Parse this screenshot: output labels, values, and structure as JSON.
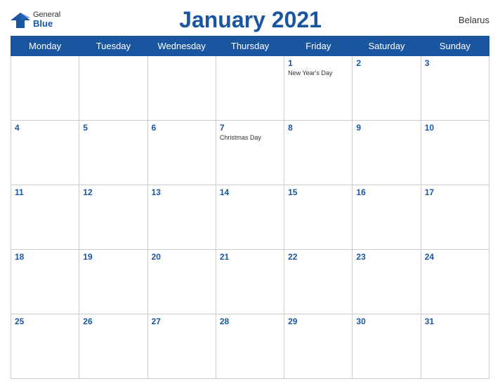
{
  "logo": {
    "general": "General",
    "blue": "Blue",
    "bird_color": "#1a56a0"
  },
  "title": "January 2021",
  "country": "Belarus",
  "days_of_week": [
    "Monday",
    "Tuesday",
    "Wednesday",
    "Thursday",
    "Friday",
    "Saturday",
    "Sunday"
  ],
  "weeks": [
    [
      {
        "day": "",
        "holiday": ""
      },
      {
        "day": "",
        "holiday": ""
      },
      {
        "day": "",
        "holiday": ""
      },
      {
        "day": "",
        "holiday": ""
      },
      {
        "day": "1",
        "holiday": "New Year's Day"
      },
      {
        "day": "2",
        "holiday": ""
      },
      {
        "day": "3",
        "holiday": ""
      }
    ],
    [
      {
        "day": "4",
        "holiday": ""
      },
      {
        "day": "5",
        "holiday": ""
      },
      {
        "day": "6",
        "holiday": ""
      },
      {
        "day": "7",
        "holiday": "Christmas Day"
      },
      {
        "day": "8",
        "holiday": ""
      },
      {
        "day": "9",
        "holiday": ""
      },
      {
        "day": "10",
        "holiday": ""
      }
    ],
    [
      {
        "day": "11",
        "holiday": ""
      },
      {
        "day": "12",
        "holiday": ""
      },
      {
        "day": "13",
        "holiday": ""
      },
      {
        "day": "14",
        "holiday": ""
      },
      {
        "day": "15",
        "holiday": ""
      },
      {
        "day": "16",
        "holiday": ""
      },
      {
        "day": "17",
        "holiday": ""
      }
    ],
    [
      {
        "day": "18",
        "holiday": ""
      },
      {
        "day": "19",
        "holiday": ""
      },
      {
        "day": "20",
        "holiday": ""
      },
      {
        "day": "21",
        "holiday": ""
      },
      {
        "day": "22",
        "holiday": ""
      },
      {
        "day": "23",
        "holiday": ""
      },
      {
        "day": "24",
        "holiday": ""
      }
    ],
    [
      {
        "day": "25",
        "holiday": ""
      },
      {
        "day": "26",
        "holiday": ""
      },
      {
        "day": "27",
        "holiday": ""
      },
      {
        "day": "28",
        "holiday": ""
      },
      {
        "day": "29",
        "holiday": ""
      },
      {
        "day": "30",
        "holiday": ""
      },
      {
        "day": "31",
        "holiday": ""
      }
    ]
  ],
  "accent_color": "#1a56a0"
}
